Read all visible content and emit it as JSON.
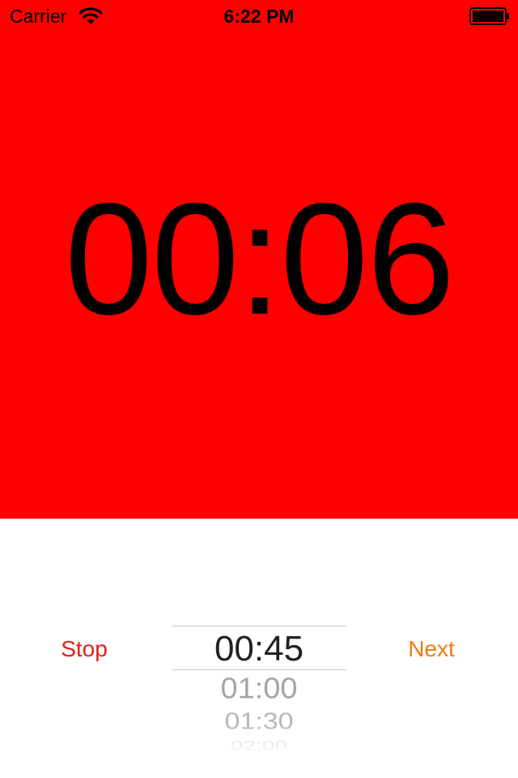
{
  "status_bar": {
    "carrier": "Carrier",
    "time": "6:22 PM",
    "wifi_icon": "wifi-icon",
    "battery_icon": "battery-full-icon"
  },
  "timer": {
    "display": "00:06",
    "background_color": "#ff0000",
    "text_color": "#000000"
  },
  "controls": {
    "stop_label": "Stop",
    "stop_color": "#e0201b",
    "next_label": "Next",
    "next_color": "#ef7d14"
  },
  "picker": {
    "selected": "00:45",
    "options": [
      "01:00",
      "01:30",
      "02:00"
    ]
  }
}
